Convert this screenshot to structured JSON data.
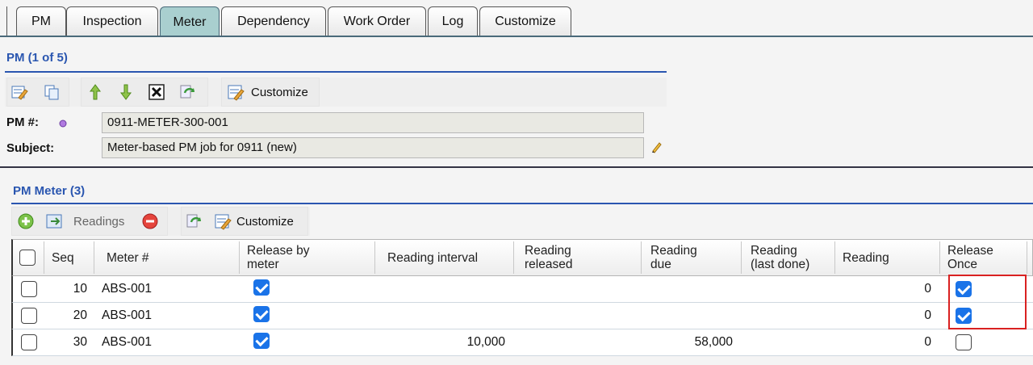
{
  "tabs": [
    {
      "label": "PM",
      "active": false
    },
    {
      "label": "Inspection",
      "active": false
    },
    {
      "label": "Meter",
      "active": true
    },
    {
      "label": "Dependency",
      "active": false
    },
    {
      "label": "Work Order",
      "active": false
    },
    {
      "label": "Log",
      "active": false
    },
    {
      "label": "Customize",
      "active": false
    }
  ],
  "pm_section": {
    "title": "PM (1 of 5)",
    "toolbar": {
      "customize_label": "Customize"
    },
    "pm_number_label": "PM #:",
    "pm_number_value": "0911-METER-300-001",
    "subject_label": "Subject:",
    "subject_value": "Meter-based PM job for 0911 (new)"
  },
  "meter_section": {
    "title": "PM Meter (3)",
    "toolbar": {
      "readings_label": "Readings",
      "customize_label": "Customize"
    },
    "columns": [
      "Seq",
      "Meter #",
      "Release by meter",
      "Reading interval",
      "Reading released",
      "Reading due",
      "Reading (last done)",
      "Reading",
      "Release Once"
    ],
    "rows": [
      {
        "seq": "10",
        "meter": "ABS-001",
        "release_by_meter": true,
        "interval": "",
        "released": "",
        "due": "",
        "last_done": "",
        "reading": "0",
        "release_once": true
      },
      {
        "seq": "20",
        "meter": "ABS-001",
        "release_by_meter": true,
        "interval": "",
        "released": "",
        "due": "",
        "last_done": "",
        "reading": "0",
        "release_once": true
      },
      {
        "seq": "30",
        "meter": "ABS-001",
        "release_by_meter": true,
        "interval": "10,000",
        "released": "",
        "due": "58,000",
        "last_done": "",
        "reading": "0",
        "release_once": false
      }
    ]
  },
  "colors": {
    "accent": "#2a56b0",
    "active_tab": "#a9cfcf",
    "checkbox": "#1a73e8",
    "highlight": "#d92121"
  }
}
